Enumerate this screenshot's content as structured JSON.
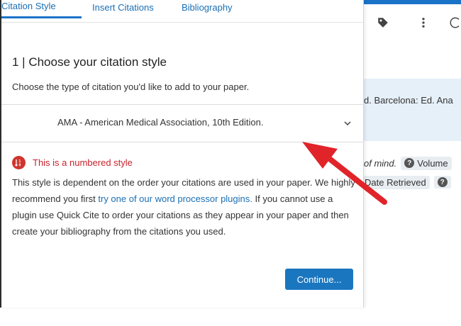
{
  "tabs": [
    {
      "label": "Citation Style",
      "active": true
    },
    {
      "label": "Insert Citations",
      "active": false
    },
    {
      "label": "Bibliography",
      "active": false
    }
  ],
  "step": {
    "title": "1 | Choose your citation style",
    "description": "Choose the type of citation you'd like to add to your paper."
  },
  "style_select": {
    "value": "AMA - American Medical Association, 10th Edition."
  },
  "notice": {
    "title": "This is a numbered style",
    "body_before_link": "This style is dependent on the order your citations are used in your paper. We highly recommend you first ",
    "link_text": "try one of our word processor plugins.",
    "body_after_link": " If you cannot use a plugin use Quick Cite to order your citations as they appear in your paper and then create your bibliography from the citations you used."
  },
  "continue_label": "Continue...",
  "background": {
    "ref_text": "d. Barcelona: Ed. Ana",
    "italic_text": "of mind.",
    "chip_volume": "Volume",
    "chip_date_retrieved": "Date Retrieved",
    "chip_qmark": "?"
  },
  "icons": {
    "tag": "tag-icon",
    "more": "more-vert-icon",
    "partial": "partial-icon",
    "notice": "numbered-list-icon",
    "chevron": "chevron-down-icon"
  },
  "colors": {
    "accent": "#1a73c8",
    "link": "#1a6fb4",
    "error_red": "#c8232c",
    "button": "#1b76c0",
    "annotation_arrow": "#e0242a",
    "highlight_strip": "#e6f0f9"
  }
}
